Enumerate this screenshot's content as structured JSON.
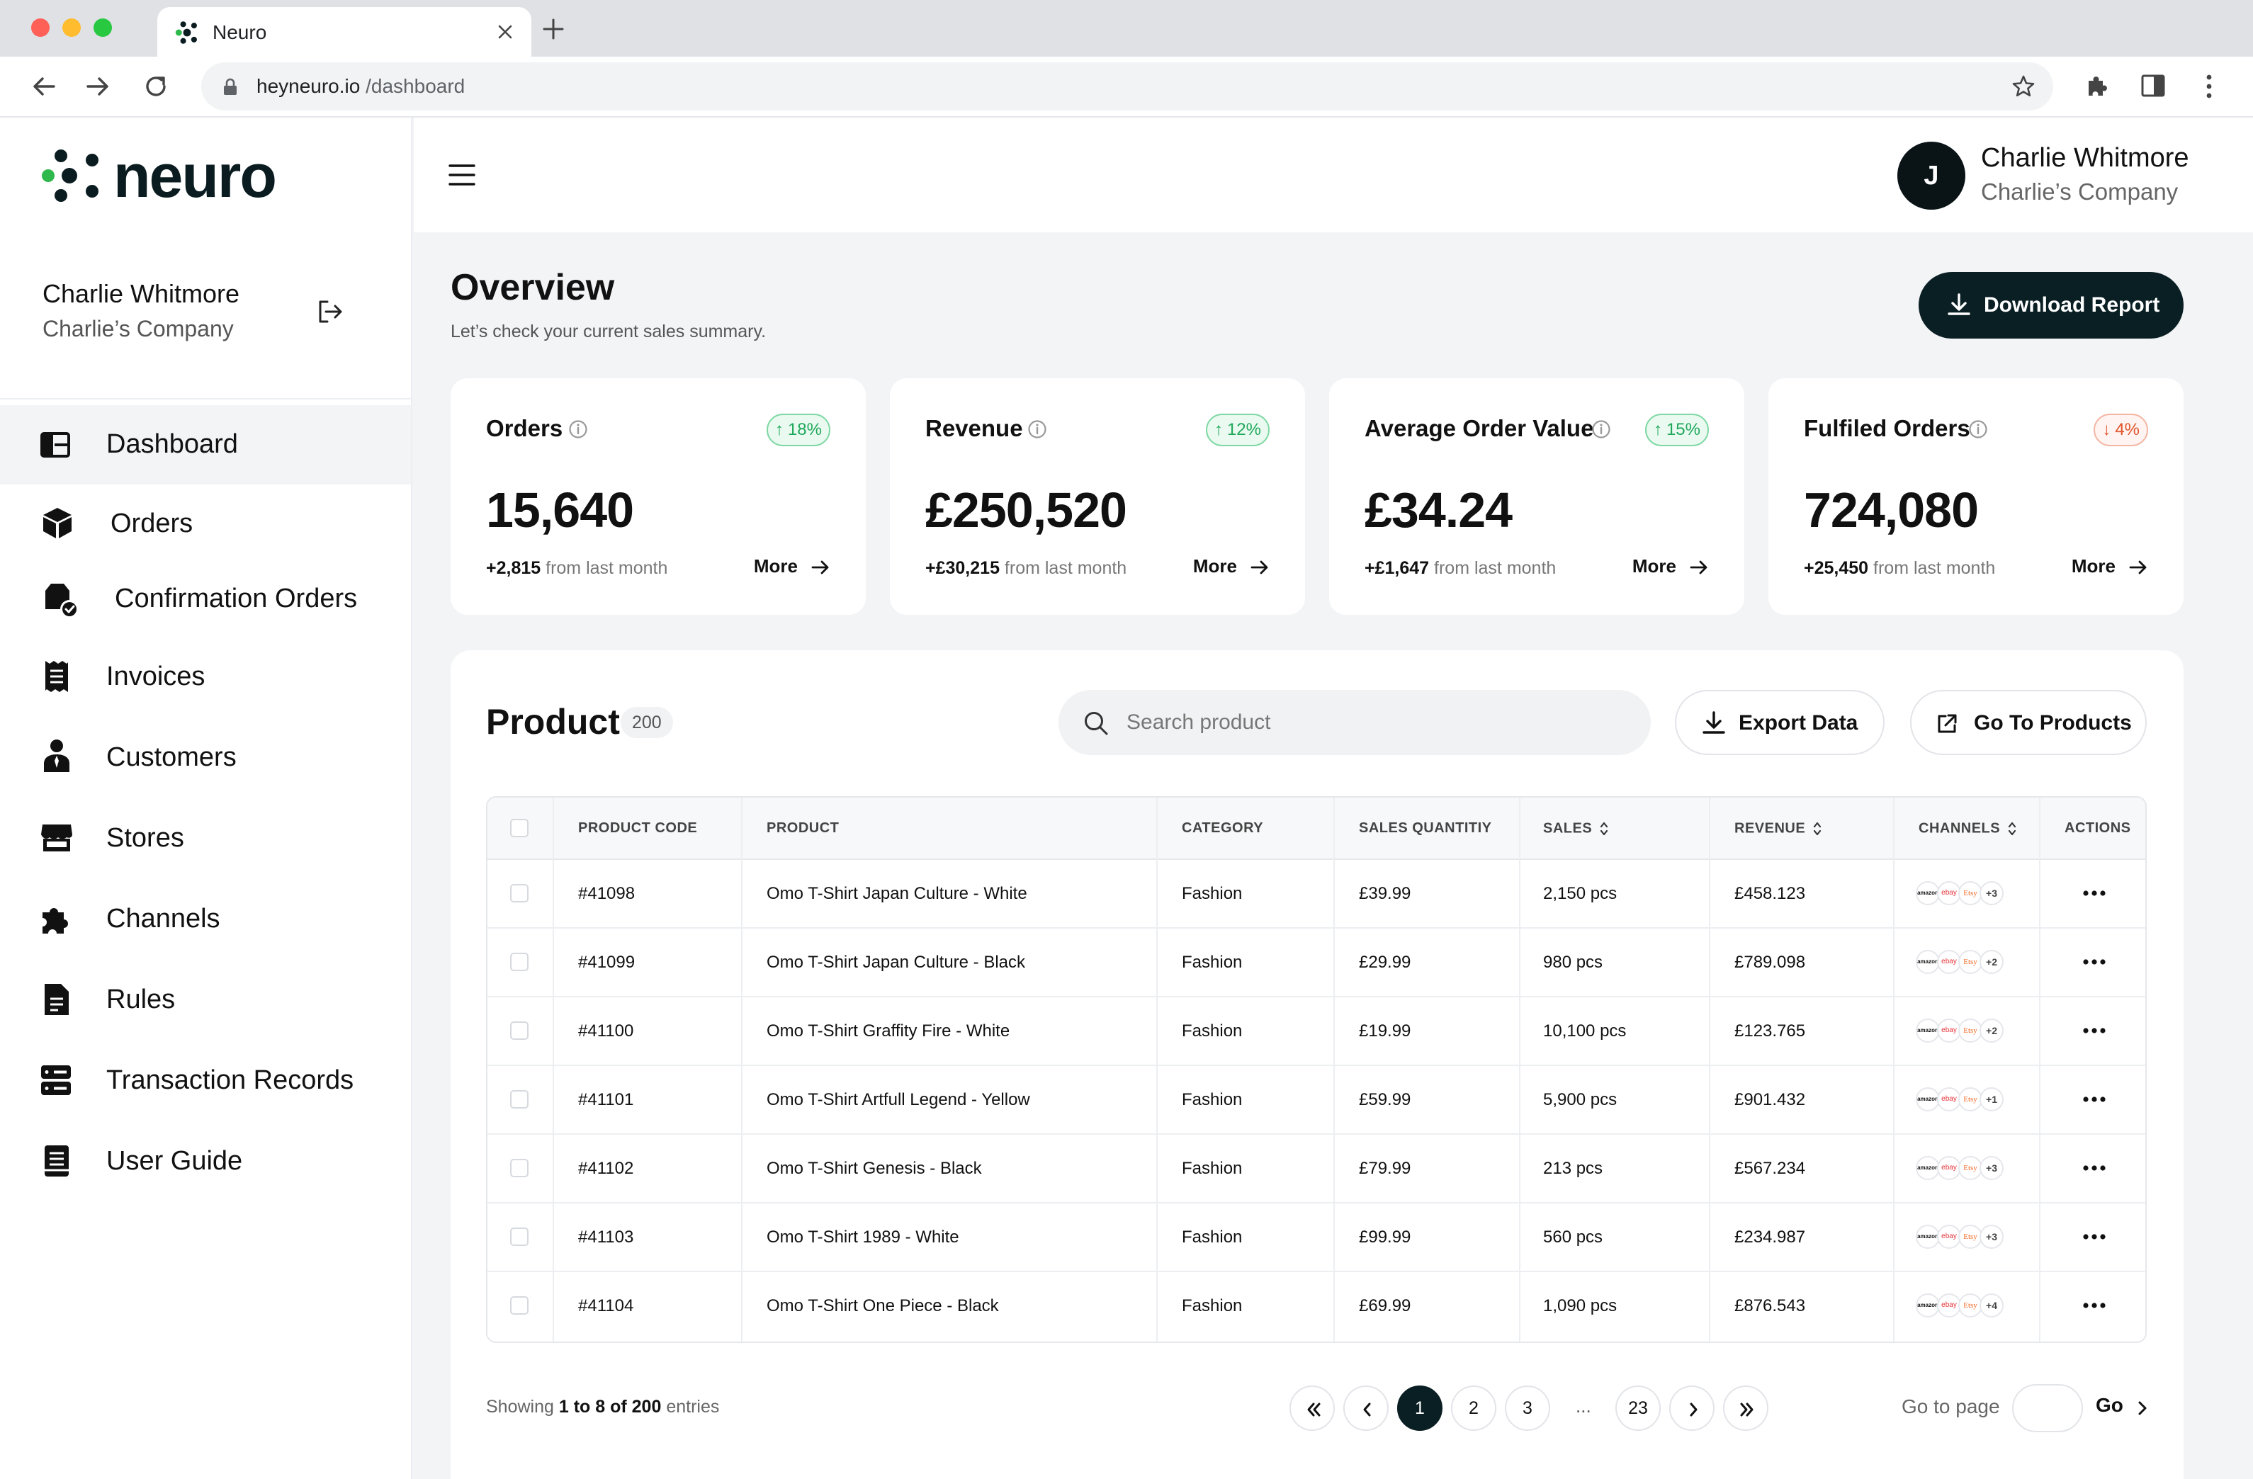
{
  "browser": {
    "tab_title": "Neuro",
    "url_host": "heyneuro.io",
    "url_path": " /dashboard"
  },
  "brand": {
    "logo_text": "neuro",
    "accent": "#2fb84c",
    "dark": "#0a1f24"
  },
  "sidebar": {
    "user_name": "Charlie Whitmore",
    "user_company": "Charlie’s Company",
    "items": [
      {
        "label": "Dashboard",
        "icon": "dashboard-icon"
      },
      {
        "label": "Orders",
        "icon": "box-icon"
      },
      {
        "label": "Confirmation Orders",
        "icon": "confirm-order-icon"
      },
      {
        "label": "Invoices",
        "icon": "receipt-icon"
      },
      {
        "label": "Customers",
        "icon": "person-icon"
      },
      {
        "label": "Stores",
        "icon": "store-icon"
      },
      {
        "label": "Channels",
        "icon": "puzzle-icon"
      },
      {
        "label": "Rules",
        "icon": "document-icon"
      },
      {
        "label": "Transaction Records",
        "icon": "server-icon"
      },
      {
        "label": "User Guide",
        "icon": "book-icon"
      }
    ]
  },
  "header": {
    "avatar_initial": "J",
    "user_name": "Charlie Whitmore",
    "user_company": "Charlie’s Company"
  },
  "overview": {
    "title": "Overview",
    "subtitle": "Let’s check your current sales summary.",
    "download_label": "Download Report"
  },
  "stats": [
    {
      "title": "Orders",
      "badge": "18%",
      "trend": "up",
      "value": "15,640",
      "delta": "+2,815",
      "delta_suffix": "from last month",
      "more": "More"
    },
    {
      "title": "Revenue",
      "badge": "12%",
      "trend": "up",
      "value": "£250,520",
      "delta": "+£30,215",
      "delta_suffix": "from last month",
      "more": "More"
    },
    {
      "title": "Average Order Value",
      "badge": "15%",
      "trend": "up",
      "value": "£34.24",
      "delta": "+£1,647",
      "delta_suffix": "from last month",
      "more": "More"
    },
    {
      "title": "Fulfiled Orders",
      "badge": "4%",
      "trend": "down",
      "value": "724,080",
      "delta": "+25,450",
      "delta_suffix": "from last month",
      "more": "More"
    }
  ],
  "product": {
    "title": "Product",
    "count": "200",
    "search_placeholder": "Search product",
    "export_label": "Export Data",
    "goto_label": "Go To Products",
    "columns": [
      "PRODUCT CODE",
      "PRODUCT",
      "CATEGORY",
      "SALES QUANTITIY",
      "SALES",
      "REVENUE",
      "CHANNELS",
      "ACTIONS"
    ],
    "rows": [
      {
        "code": "#41098",
        "product": "Omo T-Shirt Japan Culture - White",
        "category": "Fashion",
        "qty": "£39.99",
        "sales": "2,150 pcs",
        "revenue": "£458.123",
        "channels_more": "+3"
      },
      {
        "code": "#41099",
        "product": "Omo T-Shirt Japan Culture - Black",
        "category": "Fashion",
        "qty": "£29.99",
        "sales": "980 pcs",
        "revenue": "£789.098",
        "channels_more": "+2"
      },
      {
        "code": "#41100",
        "product": "Omo T-Shirt Graffity Fire - White",
        "category": "Fashion",
        "qty": "£19.99",
        "sales": "10,100 pcs",
        "revenue": "£123.765",
        "channels_more": "+2"
      },
      {
        "code": "#41101",
        "product": "Omo T-Shirt Artfull Legend - Yellow",
        "category": "Fashion",
        "qty": "£59.99",
        "sales": "5,900 pcs",
        "revenue": "£901.432",
        "channels_more": "+1"
      },
      {
        "code": "#41102",
        "product": "Omo T-Shirt Genesis - Black",
        "category": "Fashion",
        "qty": "£79.99",
        "sales": "213 pcs",
        "revenue": "£567.234",
        "channels_more": "+3"
      },
      {
        "code": "#41103",
        "product": "Omo T-Shirt 1989 - White",
        "category": "Fashion",
        "qty": "£99.99",
        "sales": "560 pcs",
        "revenue": "£234.987",
        "channels_more": "+3"
      },
      {
        "code": "#41104",
        "product": "Omo T-Shirt One Piece - Black",
        "category": "Fashion",
        "qty": "£69.99",
        "sales": "1,090 pcs",
        "revenue": "£876.543",
        "channels_more": "+4"
      }
    ],
    "channel_labels": {
      "amazon": "amazon",
      "ebay": "ebay",
      "etsy": "Etsy"
    }
  },
  "pagination": {
    "showing_prefix": "Showing",
    "showing_range": "1 to 8 of 200",
    "showing_suffix": "entries",
    "pages": [
      "1",
      "2",
      "3"
    ],
    "ellipsis": "...",
    "last_page": "23",
    "current": "1",
    "goto_label": "Go to page",
    "go_label": "Go"
  }
}
